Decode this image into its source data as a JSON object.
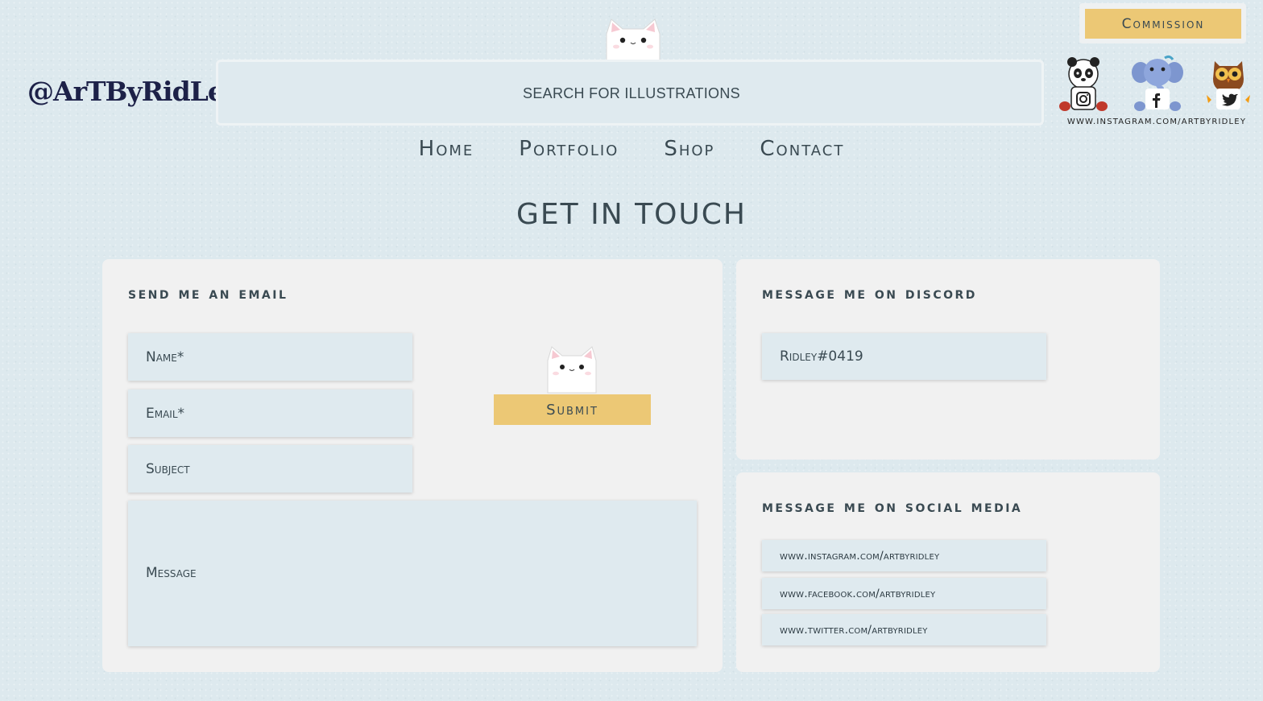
{
  "brand": {
    "logo_text": "@ArTByRidLey"
  },
  "search": {
    "placeholder": "SEARCH FOR ILLUSTRATIONS"
  },
  "header": {
    "commission_label": "Commission",
    "social_url": "www.instagram.com/artbyridley"
  },
  "nav": {
    "items": [
      "Home",
      "Portfolio",
      "Shop",
      "Contact"
    ]
  },
  "page_title": "GET IN TOUCH",
  "email_card": {
    "title": "send me an email",
    "name_placeholder": "Name*",
    "email_placeholder": "Email*",
    "subject_placeholder": "Subject",
    "message_placeholder": "Message",
    "submit_label": "Submit"
  },
  "discord_card": {
    "title": "message me on discord",
    "handle": "Ridley#0419"
  },
  "social_card": {
    "title": "message me on social media",
    "links": [
      "www.instagram.com/artbyridley",
      "www.facebook.com/artbyridley",
      "www.twitter.com/artbyridley"
    ]
  },
  "icons": [
    "cat-mascot-icon",
    "panda-instagram-icon",
    "elephant-facebook-icon",
    "owl-twitter-icon"
  ],
  "colors": {
    "accent": "#ecc875",
    "background": "#dde9ee",
    "card": "#f1f1f1",
    "field": "#dfeaef",
    "text": "#3a4a52",
    "logo": "#1d2148"
  }
}
